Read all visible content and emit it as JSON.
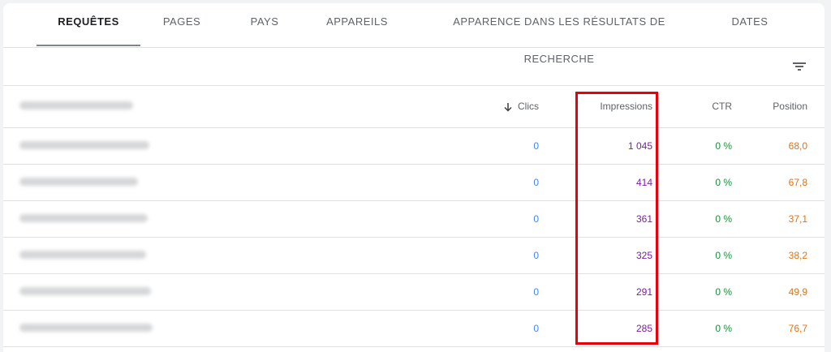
{
  "tabs": [
    {
      "label": "REQUÊTES",
      "active": true
    },
    {
      "label": "PAGES"
    },
    {
      "label": "PAYS"
    },
    {
      "label": "APPAREILS"
    },
    {
      "label": "APPARENCE DANS LES RÉSULTATS DE RECHERCHE"
    },
    {
      "label": "DATES"
    }
  ],
  "toolbar": {
    "filter_icon": "filter-list-icon"
  },
  "table": {
    "headers": {
      "query": "",
      "clics": "Clics",
      "impressions": "Impressions",
      "ctr": "CTR",
      "position": "Position"
    },
    "sort": {
      "column": "clics",
      "direction": "desc",
      "icon": "arrow-down-icon"
    },
    "rows": [
      {
        "query": "",
        "clics": "0",
        "impressions": "1 045",
        "ctr": "0 %",
        "position": "68,0"
      },
      {
        "query": "",
        "clics": "0",
        "impressions": "414",
        "ctr": "0 %",
        "position": "67,8"
      },
      {
        "query": "",
        "clics": "0",
        "impressions": "361",
        "ctr": "0 %",
        "position": "37,1"
      },
      {
        "query": "",
        "clics": "0",
        "impressions": "325",
        "ctr": "0 %",
        "position": "38,2"
      },
      {
        "query": "",
        "clics": "0",
        "impressions": "291",
        "ctr": "0 %",
        "position": "49,9"
      },
      {
        "query": "",
        "clics": "0",
        "impressions": "285",
        "ctr": "0 %",
        "position": "76,7"
      }
    ]
  },
  "colors": {
    "clics": "#4285f4",
    "impressions": "#7b1fa2",
    "ctr": "#1e8e3e",
    "position": "#e8710a",
    "highlight": "#e8000b"
  }
}
